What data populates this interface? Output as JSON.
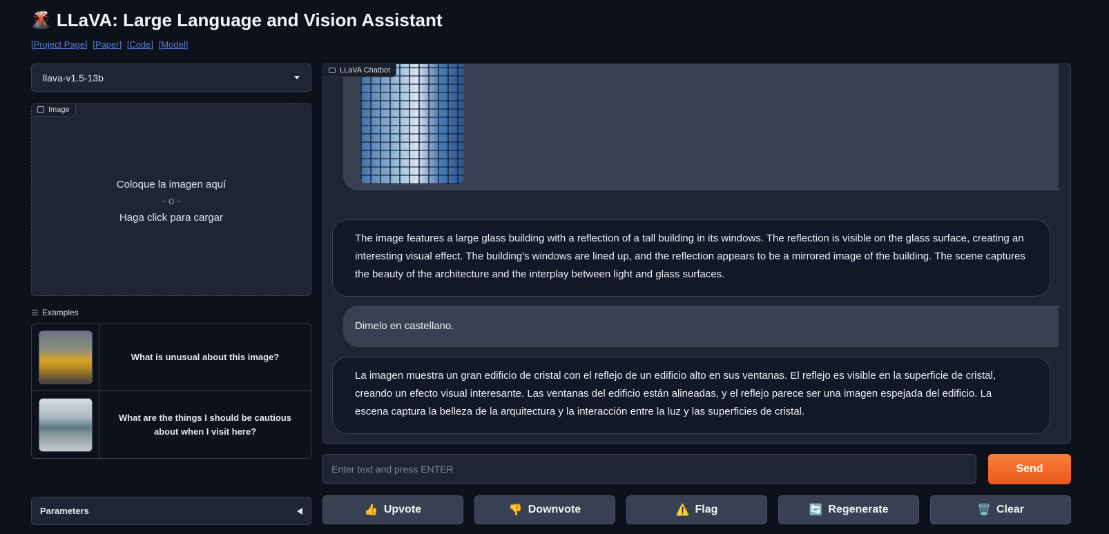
{
  "header": {
    "logo_icon": "🌋",
    "title": "LLaVA: Large Language and Vision Assistant",
    "links": [
      "[Project Page]",
      "[Paper]",
      "[Code]",
      "[Model]"
    ]
  },
  "model_select": {
    "value": "llava-v1.5-13b"
  },
  "image_upload": {
    "label": "Image",
    "drop_text": "Coloque la imagen aquí",
    "or_text": "- o -",
    "click_text": "Haga click para cargar"
  },
  "examples": {
    "label": "Examples",
    "items": [
      {
        "text": "What is unusual about this image?"
      },
      {
        "text": "What are the things I should be cautious about when I visit here?"
      }
    ]
  },
  "parameters": {
    "label": "Parameters"
  },
  "chatbot": {
    "label": "LLaVA Chatbot",
    "messages": [
      {
        "role": "bot",
        "text": "The image features a large glass building with a reflection of a tall building in its windows. The reflection is visible on the glass surface, creating an interesting visual effect. The building's windows are lined up, and the reflection appears to be a mirrored image of the building. The scene captures the beauty of the architecture and the interplay between light and glass surfaces."
      },
      {
        "role": "user",
        "text": "Dimelo en castellano."
      },
      {
        "role": "bot",
        "text": "La imagen muestra un gran edificio de cristal con el reflejo de un edificio alto en sus ventanas. El reflejo es visible en la superficie de cristal, creando un efecto visual interesante. Las ventanas del edificio están alineadas, y el reflejo parece ser una imagen espejada del edificio. La escena captura la belleza de la arquitectura y la interacción entre la luz y las superficies de cristal."
      }
    ]
  },
  "input": {
    "placeholder": "Enter text and press ENTER",
    "value": ""
  },
  "send_label": "Send",
  "actions": {
    "upvote": {
      "icon": "👍",
      "label": "Upvote"
    },
    "downvote": {
      "icon": "👎",
      "label": "Downvote"
    },
    "flag": {
      "icon": "⚠️",
      "label": "Flag"
    },
    "regenerate": {
      "icon": "🔄",
      "label": "Regenerate"
    },
    "clear": {
      "icon": "🗑️",
      "label": "Clear"
    }
  },
  "colors": {
    "accent": "#ea5a19",
    "background": "#0c111c",
    "panel": "#1f2633"
  }
}
